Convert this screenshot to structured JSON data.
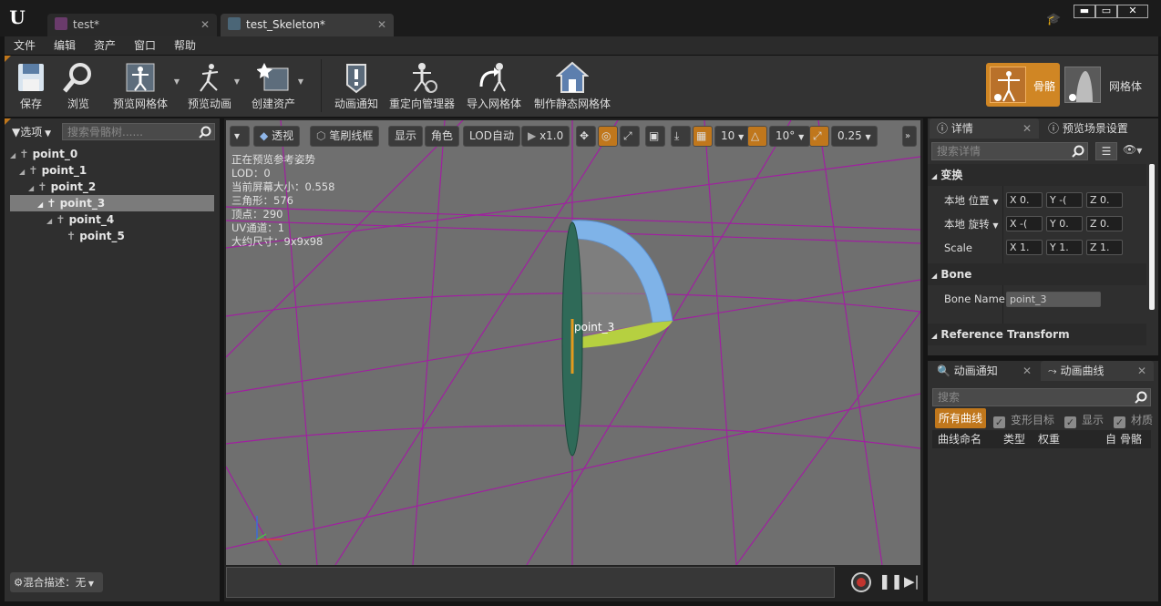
{
  "window": {
    "tabs": [
      {
        "label": "test*"
      },
      {
        "label": "test_Skeleton*"
      }
    ],
    "controls": {
      "minimize": "▬",
      "maximize": "▭",
      "close": "✕"
    }
  },
  "menu": [
    "文件",
    "编辑",
    "资产",
    "窗口",
    "帮助"
  ],
  "toolbar": {
    "items": [
      {
        "label": "保存",
        "icon": "save-icon"
      },
      {
        "label": "浏览",
        "icon": "browse-icon"
      },
      {
        "label": "预览网格体",
        "icon": "preview-mesh-icon",
        "dropdown": true
      },
      {
        "label": "预览动画",
        "icon": "preview-animation-icon",
        "dropdown": true
      },
      {
        "label": "创建资产",
        "icon": "create-asset-icon",
        "dropdown": true
      },
      {
        "label": "动画通知",
        "icon": "anim-notify-icon"
      },
      {
        "label": "重定向管理器",
        "icon": "retarget-manager-icon"
      },
      {
        "label": "导入网格体",
        "icon": "import-mesh-icon"
      },
      {
        "label": "制作静态网格体",
        "icon": "make-static-mesh-icon"
      }
    ],
    "mode_skeleton": "骨骼",
    "mode_mesh": "网格体"
  },
  "skeleton_tree": {
    "options_label": "选项",
    "search_placeholder": "搜索骨骼树......",
    "bones": [
      {
        "name": "point_0",
        "depth": 0
      },
      {
        "name": "point_1",
        "depth": 1
      },
      {
        "name": "point_2",
        "depth": 2
      },
      {
        "name": "point_3",
        "depth": 3,
        "selected": true
      },
      {
        "name": "point_4",
        "depth": 4
      },
      {
        "name": "point_5",
        "depth": 5
      }
    ],
    "blend_label": "混合描述：无"
  },
  "viewport": {
    "toolbar": {
      "perspective": "透视",
      "wireframe": "笔刷线框",
      "show": "显示",
      "character": "角色",
      "lod": "LOD自动",
      "speed": "x1.0",
      "grid_snap": "10",
      "rot_snap": "10°",
      "scale_snap": "0.25"
    },
    "stats": [
      "正在预览参考姿势",
      "LOD：0",
      "当前屏幕大小：0.558",
      "三角形：576",
      "顶点：290",
      "UV通道：1",
      "大约尺寸：9x9x98"
    ],
    "bone_label": "point_3"
  },
  "details": {
    "tab_details": "详情",
    "tab_preview": "预览场景设置",
    "search_placeholder": "搜索详情",
    "section_transform": "变换",
    "location_label": "本地 位置",
    "rotation_label": "本地 旋转",
    "scale_label": "Scale",
    "location": [
      "X 0.",
      "Y -(",
      "Z 0."
    ],
    "rotation": [
      "X -(",
      "Y 0.",
      "Z 0."
    ],
    "scale": [
      "X 1.",
      "Y 1.",
      "Z 1."
    ],
    "section_bone": "Bone",
    "bone_name_label": "Bone Name",
    "bone_name_value": "point_3",
    "section_reference": "Reference Transform"
  },
  "curves": {
    "tab_notifies": "动画通知",
    "tab_curves": "动画曲线",
    "search_placeholder": "搜索",
    "all_curves": "所有曲线",
    "filter_morph": "变形目标",
    "filter_show": "显示",
    "filter_material": "材质",
    "col_name": "曲线命名",
    "col_type": "类型",
    "col_weight": "权重",
    "col_auto": "自",
    "col_bone": "骨骼"
  },
  "colors": {
    "accent": "#c0771c",
    "grid": "#a020a0",
    "selection": "#7b7b7b"
  }
}
